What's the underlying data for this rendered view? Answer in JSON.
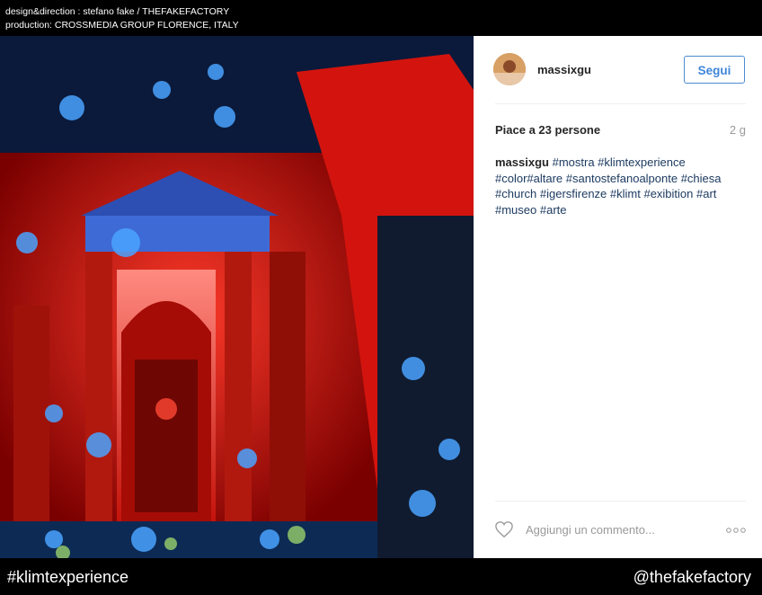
{
  "credits": {
    "line1": "design&direction : stefano fake / THEFAKEFACTORY",
    "line2": "production: CROSSMEDIA GROUP FLORENCE, ITALY"
  },
  "post": {
    "username": "massixgu",
    "follow_label": "Segui",
    "likes": "Piace a 23 persone",
    "time_ago": "2 g",
    "caption_user": "massixgu",
    "caption_tags": "#mostra #klimtexperience #color#altare #santostefanoalponte #chiesa #church #igersfirenze #klimt #exibition #art #museo #arte",
    "comment_placeholder": "Aggiungi un commento..."
  },
  "footer": {
    "hashtag": "#klimtexperience",
    "handle": "@thefakefactory"
  },
  "icons": {
    "like": "heart-icon",
    "more": "more-options-icon"
  },
  "colors": {
    "follow_button": "#3f86d9",
    "hashtag_text": "#1d3b61",
    "background": "#000000"
  }
}
